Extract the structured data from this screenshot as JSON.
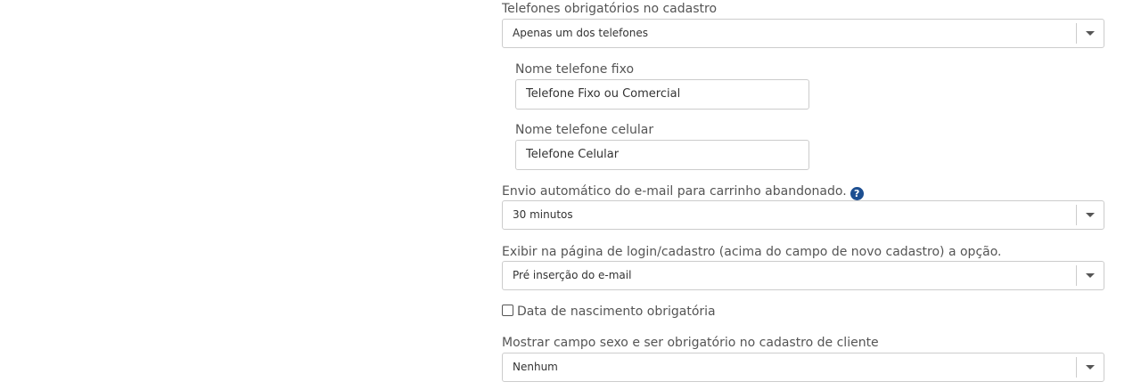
{
  "phones_required": {
    "label": "Telefones obrigatórios no cadastro",
    "selected": "Apenas um dos telefones"
  },
  "landline_name": {
    "label": "Nome telefone fixo",
    "value": "Telefone Fixo ou Comercial"
  },
  "mobile_name": {
    "label": "Nome telefone celular",
    "value": "Telefone Celular"
  },
  "abandoned_cart_email": {
    "label": "Envio automático do e-mail para carrinho abandonado.",
    "help_icon": "?",
    "selected": "30 minutos"
  },
  "login_page_option": {
    "label": "Exibir na página de login/cadastro (acima do campo de novo cadastro) a opção.",
    "selected": "Pré inserção do e-mail"
  },
  "birthdate_required": {
    "label": "Data de nascimento obrigatória",
    "checked": false
  },
  "gender_field": {
    "label": "Mostrar campo sexo e ser obrigatório no cadastro de cliente",
    "selected": "Nenhum"
  },
  "colors": {
    "help_icon": "#1d4f91",
    "border": "#cccccc",
    "label_text": "#555555"
  }
}
